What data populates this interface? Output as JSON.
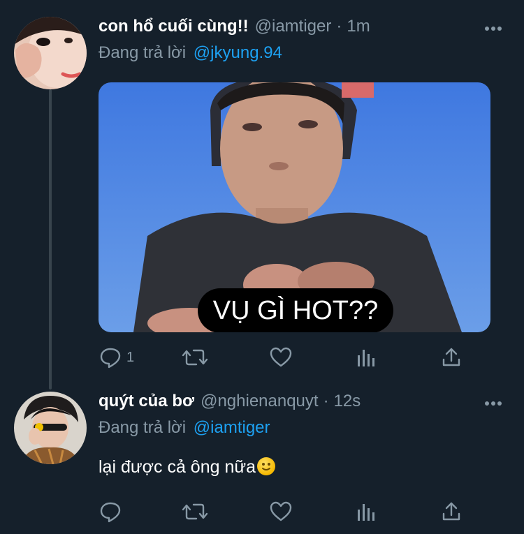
{
  "tweets": [
    {
      "display_name": "con hổ cuối cùng!!",
      "handle": "@iamtiger",
      "separator": "·",
      "time": "1m",
      "replying_label": "Đang trả lời",
      "replying_to": "@jkyung.94",
      "media_caption": "VỤ GÌ HOT??",
      "reply_count": "1"
    },
    {
      "display_name": "quýt của bơ",
      "handle": "@nghienanquyt",
      "separator": "·",
      "time": "12s",
      "replying_label": "Đang trả lời",
      "replying_to": "@iamtiger",
      "text": "lại được cả ông nữa",
      "emoji": "slightly-smiling-face"
    }
  ],
  "colors": {
    "background": "#15202b",
    "secondary_text": "#8899a6",
    "accent": "#1da1f2",
    "thread_line": "#38444d"
  }
}
